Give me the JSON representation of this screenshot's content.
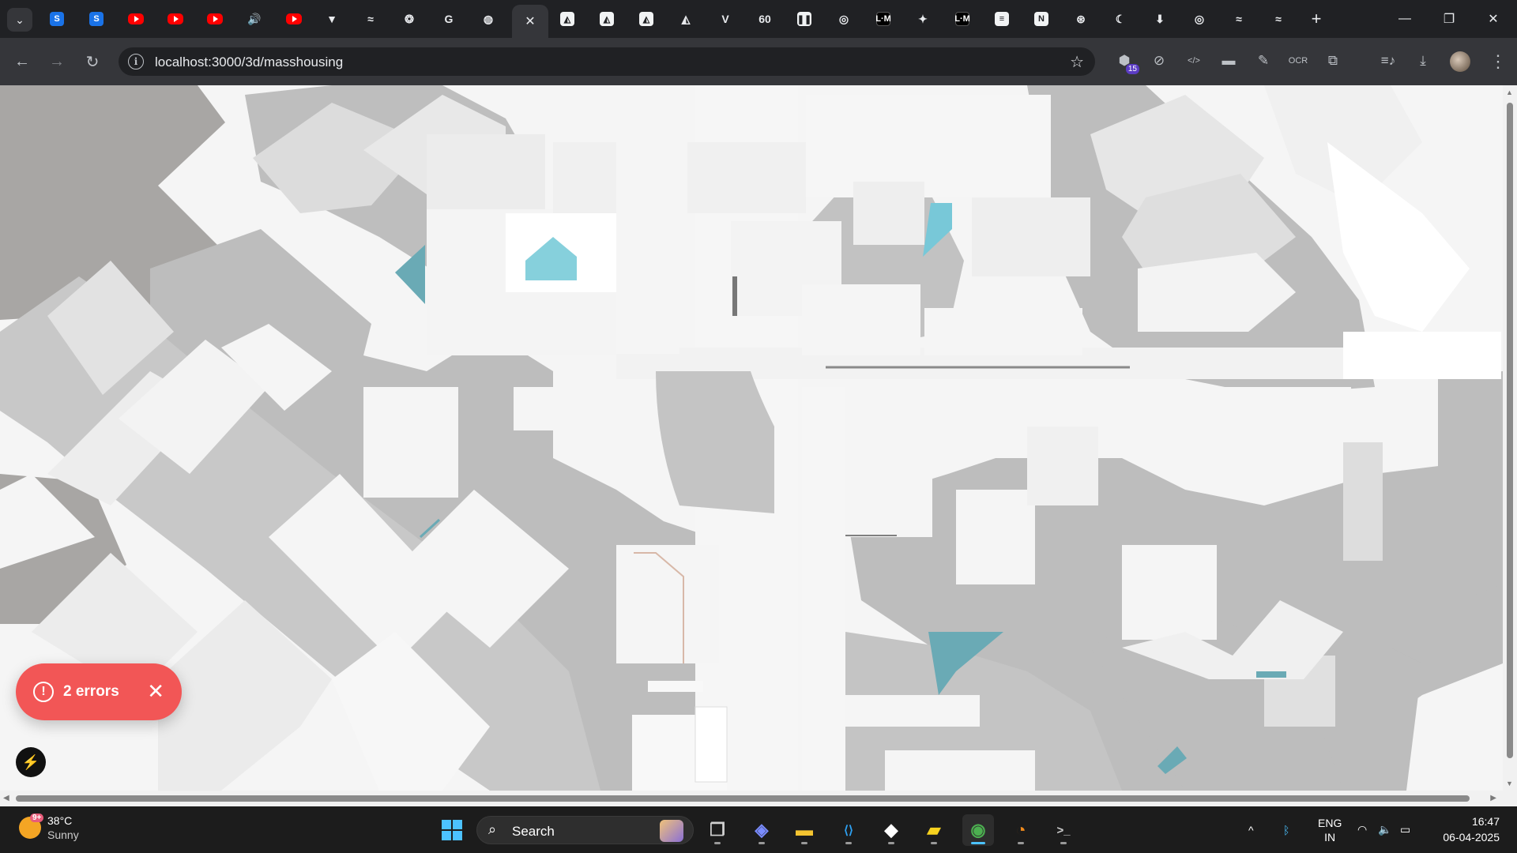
{
  "browser": {
    "tabs": [
      {
        "icon": "stackblitz-icon",
        "kind": "blue",
        "glyph": "S"
      },
      {
        "icon": "stackblitz-icon",
        "kind": "blue",
        "glyph": "S"
      },
      {
        "icon": "youtube-icon",
        "kind": "yt",
        "glyph": ""
      },
      {
        "icon": "youtube-icon",
        "kind": "yt",
        "glyph": ""
      },
      {
        "icon": "youtube-icon",
        "kind": "yt",
        "glyph": ""
      },
      {
        "icon": "audio-icon",
        "kind": "txt",
        "glyph": "🔊"
      },
      {
        "icon": "youtube-icon",
        "kind": "yt",
        "glyph": ""
      },
      {
        "icon": "vite-icon",
        "kind": "txt",
        "glyph": "▼"
      },
      {
        "icon": "zustand-icon",
        "kind": "txt",
        "glyph": "≈"
      },
      {
        "icon": "openai-icon",
        "kind": "txt",
        "glyph": "❂"
      },
      {
        "icon": "google-icon",
        "kind": "txt",
        "glyph": "G"
      },
      {
        "icon": "globe-icon",
        "kind": "txt",
        "glyph": "◍"
      },
      {
        "icon": "localhost-tab-icon",
        "kind": "active",
        "glyph": "✕"
      },
      {
        "icon": "threejs-icon",
        "kind": "white",
        "glyph": "◭"
      },
      {
        "icon": "threejs-icon",
        "kind": "white",
        "glyph": "◭"
      },
      {
        "icon": "threejs-icon",
        "kind": "white",
        "glyph": "◭"
      },
      {
        "icon": "threejs-icon",
        "kind": "txt",
        "glyph": "◭"
      },
      {
        "icon": "vercel-icon",
        "kind": "txt",
        "glyph": "V"
      },
      {
        "icon": "sixty-icon",
        "kind": "txt",
        "glyph": "60"
      },
      {
        "icon": "pause-app-icon",
        "kind": "white",
        "glyph": "❚❚"
      },
      {
        "icon": "chrome-icon",
        "kind": "txt",
        "glyph": "◎"
      },
      {
        "icon": "lm-icon",
        "kind": "dark",
        "glyph": "L·M"
      },
      {
        "icon": "sparkle-icon",
        "kind": "txt",
        "glyph": "✦"
      },
      {
        "icon": "lm-icon",
        "kind": "dark",
        "glyph": "L·M"
      },
      {
        "icon": "notes-icon",
        "kind": "white",
        "glyph": "≡"
      },
      {
        "icon": "notion-icon",
        "kind": "white",
        "glyph": "N"
      },
      {
        "icon": "pwa-icon",
        "kind": "txt",
        "glyph": "⊛"
      },
      {
        "icon": "moon-icon",
        "kind": "txt",
        "glyph": "☾"
      },
      {
        "icon": "download-icon",
        "kind": "txt",
        "glyph": "⬇"
      },
      {
        "icon": "chrome-icon",
        "kind": "txt",
        "glyph": "◎"
      },
      {
        "icon": "zustand-icon",
        "kind": "txt",
        "glyph": "≈"
      },
      {
        "icon": "zustand-icon",
        "kind": "txt",
        "glyph": "≈"
      }
    ],
    "new_tab": "+",
    "window": {
      "minimize": "—",
      "restore": "❐",
      "close": "✕"
    },
    "toolbar": {
      "back": "←",
      "forward": "→",
      "reload": "↻",
      "url": "localhost:3000/3d/masshousing",
      "info": "i",
      "star": "☆"
    },
    "extensions": [
      {
        "icon": "extension-purple-icon",
        "glyph": "⬢",
        "badge": "15"
      },
      {
        "icon": "compass-icon",
        "glyph": "⊘",
        "badge": ""
      },
      {
        "icon": "devtools-icon",
        "glyph": "</>",
        "badge": ""
      },
      {
        "icon": "tag-icon",
        "glyph": "▬",
        "badge": ""
      },
      {
        "icon": "eyedropper-icon",
        "glyph": "✎",
        "badge": ""
      },
      {
        "icon": "ocr-icon",
        "glyph": "OCR",
        "badge": ""
      },
      {
        "icon": "puzzle-icon",
        "glyph": "⧉",
        "badge": ""
      },
      {
        "icon": "media-icon",
        "glyph": "≡♪",
        "badge": ""
      },
      {
        "icon": "download-icon",
        "glyph": "⤓",
        "badge": ""
      }
    ],
    "menu": "⋮"
  },
  "overlay": {
    "errors_label": "2 errors",
    "error_icon": "!",
    "close": "✕",
    "bolt": "⚡"
  },
  "taskbar": {
    "weather": {
      "temp": "38°C",
      "condition": "Sunny",
      "badge": "9+"
    },
    "search_label": "Search",
    "apps": [
      {
        "icon": "task-view-icon",
        "glyph": "❐",
        "color": "#d0d0d0",
        "active": false
      },
      {
        "icon": "copilot-icon",
        "glyph": "◈",
        "color": "#7a8cff",
        "active": false
      },
      {
        "icon": "file-explorer-icon",
        "glyph": "▬",
        "color": "#f4c430",
        "active": false
      },
      {
        "icon": "vscode-icon",
        "glyph": "⟨⟩",
        "color": "#2ea1f2",
        "active": false
      },
      {
        "icon": "app-cube-icon",
        "glyph": "◆",
        "color": "#ffffff",
        "active": false
      },
      {
        "icon": "sticky-notes-icon",
        "glyph": "▰",
        "color": "#f7d21f",
        "active": false
      },
      {
        "icon": "chrome-icon",
        "glyph": "◉",
        "color": "#4caf50",
        "active": true
      },
      {
        "icon": "blender-icon",
        "glyph": "◔",
        "color": "#f08a1c",
        "active": false
      },
      {
        "icon": "terminal-icon",
        "glyph": ">_",
        "color": "#cccccc",
        "active": false
      }
    ],
    "tray": {
      "chevron": "^",
      "bluetooth": "ᛒ",
      "lang1": "ENG",
      "lang2": "IN",
      "wifi": "◠",
      "volume": "🔈",
      "battery": "▭"
    },
    "time": "16:47",
    "date": "06-04-2025"
  }
}
